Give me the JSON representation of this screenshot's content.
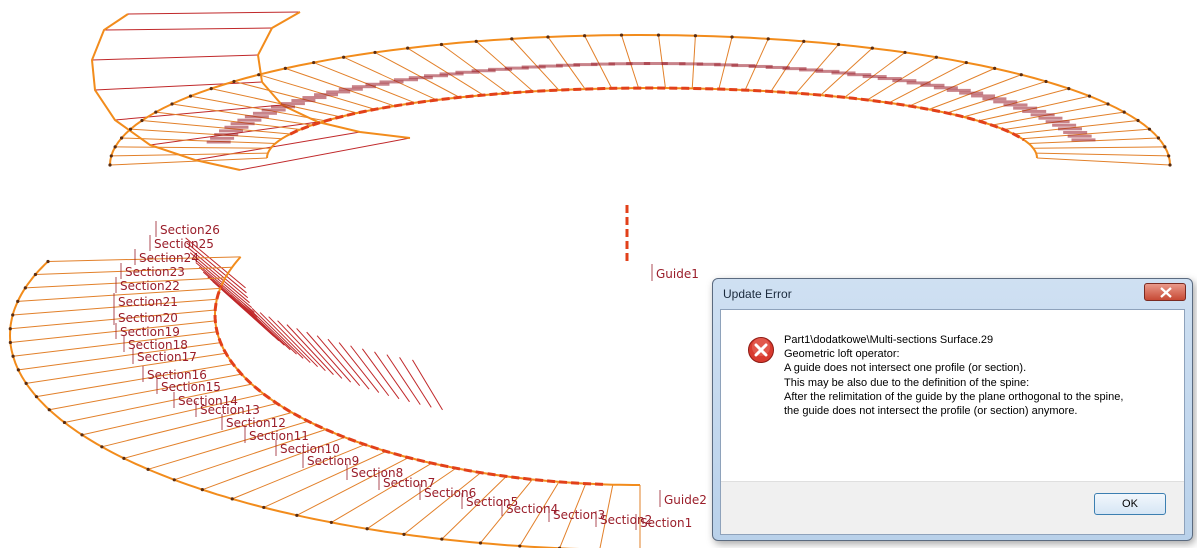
{
  "sections": [
    "Section1",
    "Section2",
    "Section3",
    "Section4",
    "Section5",
    "Section6",
    "Section7",
    "Section8",
    "Section9",
    "Section10",
    "Section11",
    "Section12",
    "Section13",
    "Section14",
    "Section15",
    "Section16",
    "Section17",
    "Section18",
    "Section19",
    "Section20",
    "Section21",
    "Section22",
    "Section23",
    "Section24",
    "Section25",
    "Section26"
  ],
  "guides": {
    "guide1": "Guide1",
    "guide2": "Guide2"
  },
  "dialog": {
    "title": "Update Error",
    "close_icon": "close-x-icon",
    "error_icon": "error-circle-icon",
    "lines": [
      "Part1\\dodatkowe\\Multi-sections Surface.29",
      "Geometric loft operator:",
      "A guide does not intersect one profile (or section).",
      "This may be also due to the definition of the spine:",
      "After the relimitation of the guide by the plane orthogonal to the spine,",
      "the guide does not intersect the profile (or section) anymore."
    ],
    "ok_label": "OK"
  },
  "colors": {
    "rail": "#f28c1c",
    "section": "#e2802a",
    "annotation": "#9a1e2a",
    "error": "#c62020",
    "dialog_frame": "#b9d1ea"
  }
}
